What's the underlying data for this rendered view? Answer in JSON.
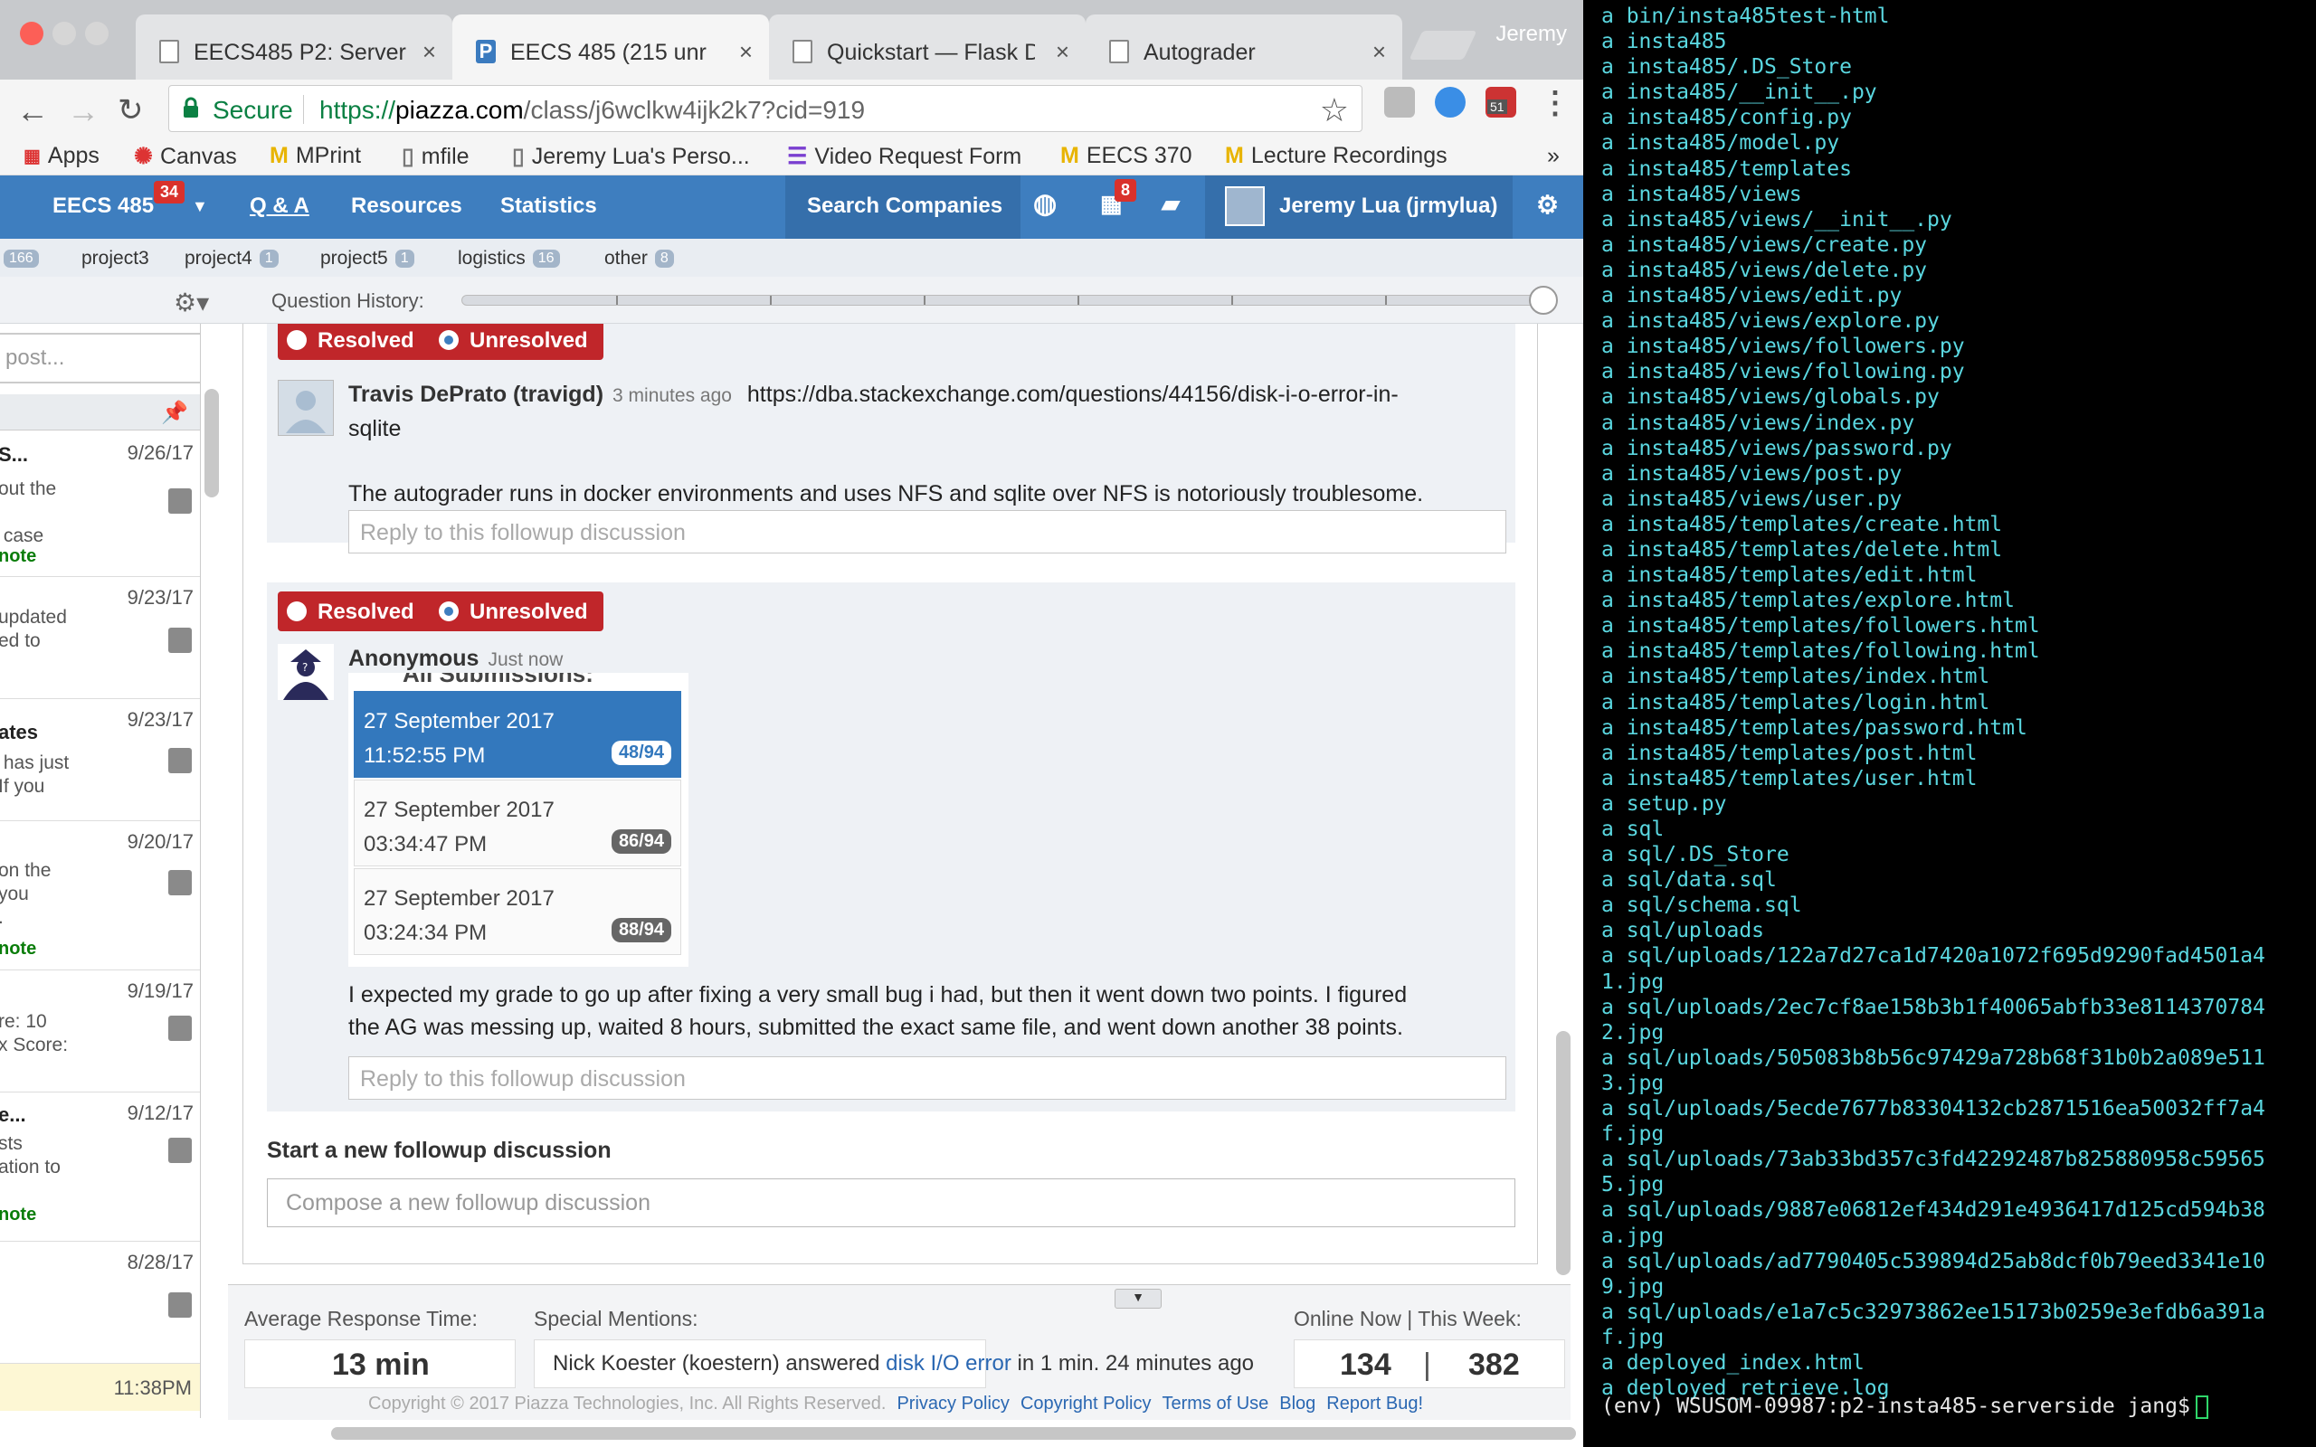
{
  "browser": {
    "profile_name": "Jeremy",
    "tabs": [
      {
        "title": "EECS485 P2: Server",
        "icon": "document-icon",
        "active": false
      },
      {
        "title": "EECS 485 (215 unr",
        "icon": "piazza-icon",
        "active": true
      },
      {
        "title": "Quickstart — Flask D",
        "icon": "document-icon",
        "active": false
      },
      {
        "title": "Autograder",
        "icon": "document-icon",
        "active": false
      }
    ],
    "secure_label": "Secure",
    "url_scheme": "https://",
    "url_host": "piazza.com",
    "url_path": "/class/j6wclkw4ijk2k7?cid=919",
    "extension_badge": "51",
    "bookmarks": [
      {
        "label": "Apps",
        "icon": "apps-grid-icon"
      },
      {
        "label": "Canvas",
        "icon": "canvas-icon"
      },
      {
        "label": "MPrint",
        "icon": "michigan-m-icon"
      },
      {
        "label": "mfile",
        "icon": "document-icon"
      },
      {
        "label": "Jeremy Lua's Perso...",
        "icon": "document-icon"
      },
      {
        "label": "Video Request Form",
        "icon": "form-icon"
      },
      {
        "label": "EECS 370",
        "icon": "michigan-m-icon"
      },
      {
        "label": "Lecture Recordings",
        "icon": "michigan-m-icon"
      }
    ],
    "bookmarks_overflow": "»"
  },
  "piazza": {
    "nav": {
      "class_name": "EECS 485",
      "class_badge": "34",
      "qa": "Q & A",
      "resources": "Resources",
      "statistics": "Statistics",
      "search_companies": "Search Companies",
      "calendar_badge": "8",
      "user": "Jeremy Lua (jrmylua)"
    },
    "folders": [
      {
        "label": "",
        "count": "166"
      },
      {
        "label": "project3",
        "count": ""
      },
      {
        "label": "project4",
        "count": "1"
      },
      {
        "label": "project5",
        "count": "1"
      },
      {
        "label": "logistics",
        "count": "16"
      },
      {
        "label": "other",
        "count": "8"
      }
    ],
    "question_history_label": "Question History:",
    "feed": {
      "search_placeholder": "post...",
      "items": [
        {
          "title": "S...",
          "date": "9/26/17",
          "body": "out the\n\n case",
          "note": "note"
        },
        {
          "title": "",
          "date": "9/23/17",
          "body": "updated\ned to",
          "note": ""
        },
        {
          "title": "ates",
          "date": "9/23/17",
          "body": " has just\nIf you",
          "note": ""
        },
        {
          "title": "",
          "date": "9/20/17",
          "body": "on the\nyou\n.",
          "note": "note"
        },
        {
          "title": "",
          "date": "9/19/17",
          "body": "re: 10\nx Score:",
          "note": ""
        },
        {
          "title": "e...",
          "date": "9/12/17",
          "body": "sts\nation to",
          "note": "note"
        },
        {
          "title": "",
          "date": "8/28/17",
          "body": "",
          "note": ""
        }
      ],
      "last_time": "11:38PM"
    },
    "followups": [
      {
        "resolved_label": "Resolved",
        "unresolved_label": "Unresolved",
        "author": "Travis DePrato (travigd)",
        "time": "3 minutes ago",
        "text_line1": "https://dba.stackexchange.com/questions/44156/disk-i-o-error-in-",
        "text_line2": "sqlite",
        "text_line3": "The autograder runs in docker environments and uses NFS and sqlite over NFS is notoriously troublesome.",
        "reply_placeholder": "Reply to this followup discussion"
      },
      {
        "resolved_label": "Resolved",
        "unresolved_label": "Unresolved",
        "author": "Anonymous",
        "time": "Just now",
        "embedded_header": "All Submissions:",
        "submissions": [
          {
            "date": "27 September 2017 11:52:55 PM",
            "score": "48/94"
          },
          {
            "date": "27 September 2017 03:34:47 PM",
            "score": "86/94"
          },
          {
            "date": "27 September 2017 03:24:34 PM",
            "score": "88/94"
          }
        ],
        "text_line1": "I expected my grade to go up after fixing a very small bug i had, but then it went down two points. I figured",
        "text_line2": "the AG was messing up, waited 8 hours, submitted the exact same file, and went down another 38 points.",
        "reply_placeholder": "Reply to this followup discussion"
      }
    ],
    "start_followup_label": "Start a new followup discussion",
    "compose_placeholder": "Compose a new followup discussion",
    "stats": {
      "avg_label": "Average Response Time:",
      "avg_value": "13 min",
      "mentions_label": "Special Mentions:",
      "mention_prefix": "Nick Koester (koestern) answered ",
      "mention_link": "disk I/O error",
      "mention_suffix": " in 1 min. 24 minutes ago",
      "online_label": "Online Now",
      "week_label": "This Week:",
      "online_value": "134",
      "week_value": "382",
      "sep": "|"
    },
    "footer": {
      "copyright": "Copyright © 2017 Piazza Technologies, Inc. All Rights Reserved.",
      "links": [
        "Privacy Policy",
        "Copyright Policy",
        "Terms of Use",
        "Blog",
        "Report Bug!"
      ]
    }
  },
  "terminal": {
    "lines": [
      "a bin/insta485test-html",
      "a insta485",
      "a insta485/.DS_Store",
      "a insta485/__init__.py",
      "a insta485/config.py",
      "a insta485/model.py",
      "a insta485/templates",
      "a insta485/views",
      "a insta485/views/__init__.py",
      "a insta485/views/create.py",
      "a insta485/views/delete.py",
      "a insta485/views/edit.py",
      "a insta485/views/explore.py",
      "a insta485/views/followers.py",
      "a insta485/views/following.py",
      "a insta485/views/globals.py",
      "a insta485/views/index.py",
      "a insta485/views/password.py",
      "a insta485/views/post.py",
      "a insta485/views/user.py",
      "a insta485/templates/create.html",
      "a insta485/templates/delete.html",
      "a insta485/templates/edit.html",
      "a insta485/templates/explore.html",
      "a insta485/templates/followers.html",
      "a insta485/templates/following.html",
      "a insta485/templates/index.html",
      "a insta485/templates/login.html",
      "a insta485/templates/password.html",
      "a insta485/templates/post.html",
      "a insta485/templates/user.html",
      "a setup.py",
      "a sql",
      "a sql/.DS_Store",
      "a sql/data.sql",
      "a sql/schema.sql",
      "a sql/uploads",
      "a sql/uploads/122a7d27ca1d7420a1072f695d9290fad4501a4",
      "1.jpg",
      "a sql/uploads/2ec7cf8ae158b3b1f40065abfb33e8114370784",
      "2.jpg",
      "a sql/uploads/505083b8b56c97429a728b68f31b0b2a089e511",
      "3.jpg",
      "a sql/uploads/5ecde7677b83304132cb2871516ea50032ff7a4",
      "f.jpg",
      "a sql/uploads/73ab33bd357c3fd42292487b825880958c59565",
      "5.jpg",
      "a sql/uploads/9887e06812ef434d291e4936417d125cd594b38",
      "a.jpg",
      "a sql/uploads/ad7790405c539894d25ab8dcf0b79eed3341e10",
      "9.jpg",
      "a sql/uploads/e1a7c5c32973862ee15173b0259e3efdb6a391a",
      "f.jpg",
      "a deployed_index.html",
      "a deployed_retrieve.log"
    ],
    "prompt": "(env) WSUSOM-09987:p2-insta485-serverside jang$"
  }
}
